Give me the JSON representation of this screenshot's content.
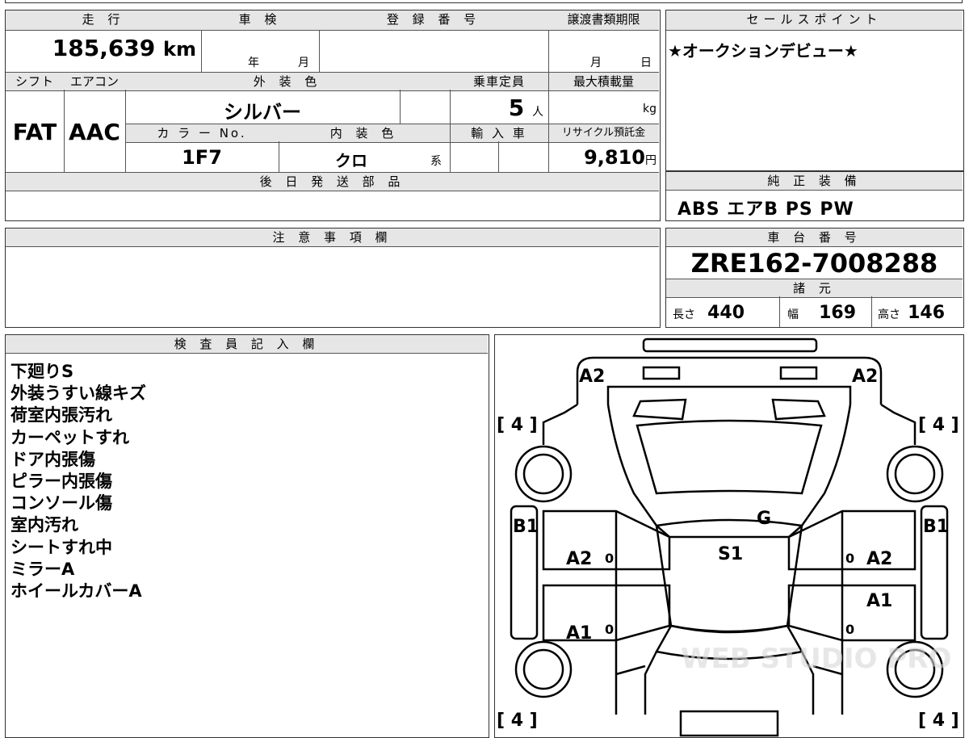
{
  "vehicle": {
    "mileage_label": "走 行",
    "mileage": "185,639",
    "mileage_unit": "km",
    "inspection_label": "車 検",
    "inspection_year": "年",
    "inspection_month": "月",
    "registration_label": "登 録 番 号",
    "transfer_label": "譲渡書類期限",
    "transfer_month": "月",
    "transfer_day": "日",
    "shift_label": "シフト",
    "shift": "FAT",
    "ac_label": "エアコン",
    "ac": "AAC",
    "exterior_color_label": "外 装 色",
    "exterior_color": "シルバー",
    "capacity_label": "乗車定員",
    "capacity": "5",
    "capacity_unit": "人",
    "max_load_label": "最大積載量",
    "max_load_unit": "kg",
    "color_no_label": "カ ラ ー No.",
    "color_no": "1F7",
    "interior_color_label": "内 装 色",
    "interior_color": "クロ",
    "interior_suffix": "系",
    "import_label": "輸 入 車",
    "recycle_label": "リサイクル預託金",
    "recycle_fee": "9,810",
    "recycle_unit": "円",
    "later_parts_label": "後 日 発 送 部 品"
  },
  "sales": {
    "label": "セールスポイント",
    "text": "★オークションデビュー★"
  },
  "equipment": {
    "label": "純 正 装 備",
    "text": "ABS エアB PS PW"
  },
  "caution": {
    "label": "注 意 事 項 欄"
  },
  "chassis": {
    "label": "車 台 番 号",
    "number": "ZRE162-7008288",
    "specs_label": "諸 元",
    "length_label": "長さ",
    "length": "440",
    "width_label": "幅",
    "width": "169",
    "height_label": "高さ",
    "height": "146"
  },
  "inspector": {
    "label": "検 査 員 記 入 欄",
    "notes": [
      "下廻りS",
      "外装うすい線キズ",
      "荷室内張汚れ",
      "カーペットすれ",
      "ドア内張傷",
      "ピラー内張傷",
      "コンソール傷",
      "室内汚れ",
      "シートすれ中",
      "ミラーA",
      "ホイールカバーA"
    ]
  },
  "diagram": {
    "tire_marks": [
      "[ 4 ]",
      "[ 4 ]",
      "[ 4 ]",
      "[ 4 ]"
    ],
    "marks": {
      "rear_left": "A2",
      "rear_right": "A2",
      "left_pillar": "B1",
      "right_pillar": "B1",
      "glass": "G",
      "roof": "S1",
      "left_rear_door": "A2",
      "right_rear_door": "A2",
      "left_front_door": "A1",
      "right_front_door": "A1",
      "zero": "0"
    },
    "watermark": "WEB STUDIO PRO"
  }
}
